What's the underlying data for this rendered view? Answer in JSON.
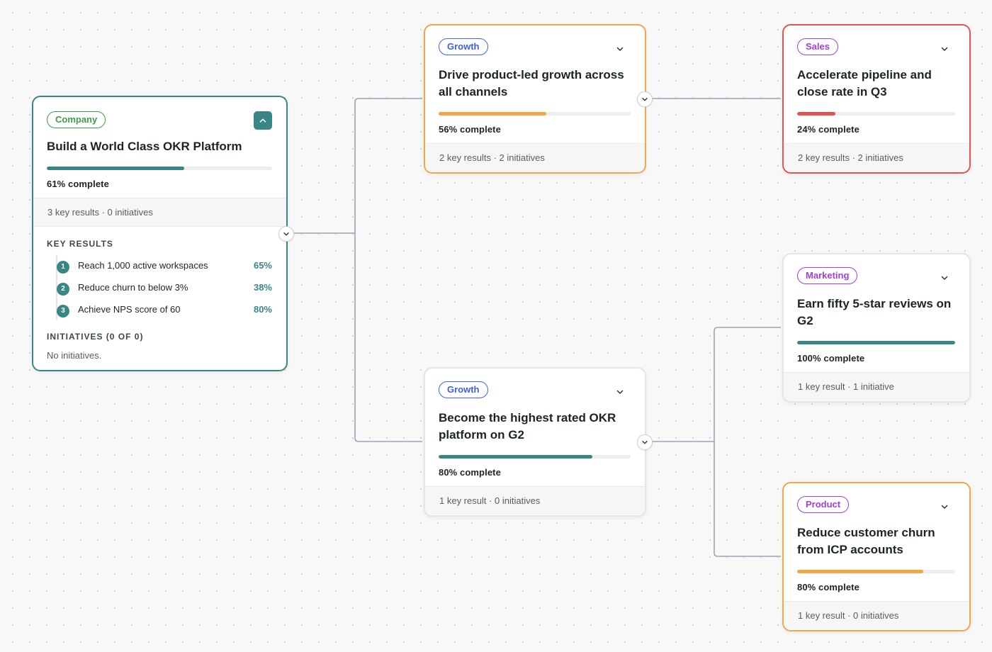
{
  "colors": {
    "teal": "#3a8586",
    "orange": "#f0a64a",
    "red": "#e05454",
    "purple": "#a33fd6",
    "blue": "#3f62d9",
    "green_tag": "#3e9a4a",
    "connector": "#97a6b8"
  },
  "company": {
    "tag": "Company",
    "title": "Build a World Class OKR Platform",
    "progress": 61,
    "pct_label": "61% complete",
    "meta": "3 key results · 0 initiatives",
    "collapse_icon": "chevron-up-icon",
    "key_results_label": "KEY RESULTS",
    "key_results": [
      {
        "num": "1",
        "text": "Reach 1,000 active workspaces",
        "pct": "65%"
      },
      {
        "num": "2",
        "text": "Reduce churn to below 3%",
        "pct": "38%"
      },
      {
        "num": "3",
        "text": "Achieve NPS score of 60",
        "pct": "80%"
      }
    ],
    "initiatives_label": "INITIATIVES (0 OF 0)",
    "initiatives_empty": "No initiatives."
  },
  "growth1": {
    "tag": "Growth",
    "title": "Drive product-led growth across all channels",
    "progress": 56,
    "pct_label": "56% complete",
    "meta": "2 key results · 2 initiatives"
  },
  "growth2": {
    "tag": "Growth",
    "title": "Become the highest rated OKR platform on G2",
    "progress": 80,
    "pct_label": "80% complete",
    "meta": "1 key result · 0 initiatives"
  },
  "sales": {
    "tag": "Sales",
    "title": "Accelerate pipeline and close rate in Q3",
    "progress": 24,
    "pct_label": "24% complete",
    "meta": "2 key results · 2 initiatives"
  },
  "marketing": {
    "tag": "Marketing",
    "title": "Earn fifty 5-star reviews on G2",
    "progress": 100,
    "pct_label": "100% complete",
    "meta": "1 key result · 1 initiative"
  },
  "product": {
    "tag": "Product",
    "title": "Reduce customer churn from ICP accounts",
    "progress": 80,
    "pct_label": "80% complete",
    "meta": "1 key result · 0 initiatives"
  }
}
